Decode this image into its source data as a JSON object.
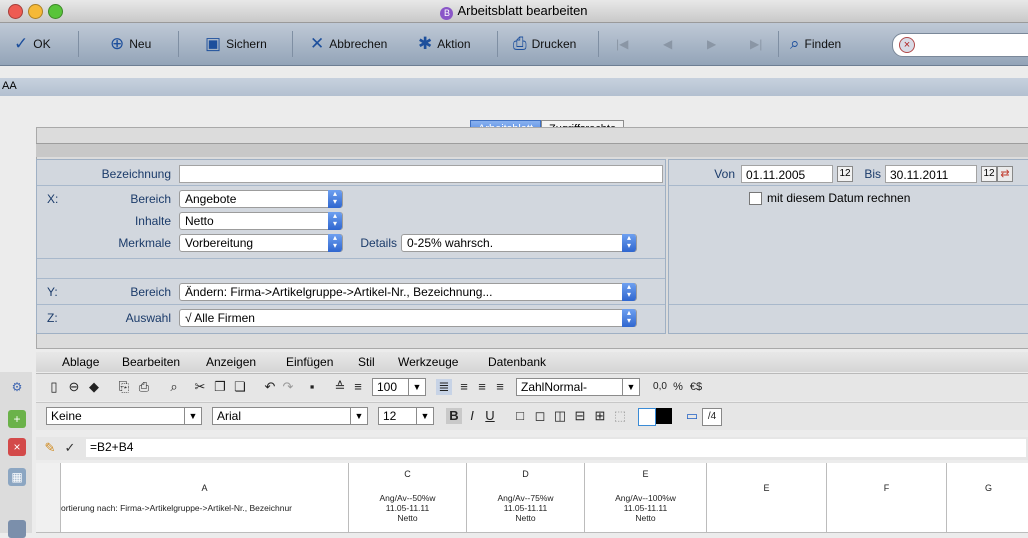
{
  "window": {
    "title": "Arbeitsblatt bearbeiten"
  },
  "toolbar": {
    "ok": "OK",
    "new": "Neu",
    "save": "Sichern",
    "cancel": "Abbrechen",
    "action": "Aktion",
    "print": "Drucken",
    "find": "Finden"
  },
  "strip": {
    "label": "AA"
  },
  "tabs": {
    "sheet": "Arbeitsblatt",
    "access": "Zugriffsrechte"
  },
  "form": {
    "bezeichnung_label": "Bezeichnung",
    "bezeichnung_value": "",
    "x_label": "X:",
    "bereich_label": "Bereich",
    "bereich_value": "Angebote",
    "inhalte_label": "Inhalte",
    "inhalte_value": "Netto",
    "merkmale_label": "Merkmale",
    "merkmale_value": "Vorbereitung",
    "details_label": "Details",
    "details_value": "0-25% wahrsch.",
    "y_label": "Y:",
    "y_bereich_label": "Bereich",
    "y_bereich_value": "Ändern: Firma->Artikelgruppe->Artikel-Nr., Bezeichnung...",
    "z_label": "Z:",
    "auswahl_label": "Auswahl",
    "auswahl_value": "√  Alle Firmen",
    "von_label": "Von",
    "von_value": "01.11.2005",
    "bis_label": "Bis",
    "bis_value": "30.11.2011",
    "date_checkbox_label": "mit diesem Datum rechnen"
  },
  "menu": [
    "Ablage",
    "Bearbeiten",
    "Anzeigen",
    "Einfügen",
    "Stil",
    "Werkzeuge",
    "Datenbank"
  ],
  "toolbar1": {
    "zoom": "100",
    "style": "ZahlNormal-",
    "num_format": "0,0",
    "percent": "%"
  },
  "toolbar2": {
    "border": "Keine",
    "font": "Arial",
    "size": "12",
    "bold": "B",
    "italic": "I",
    "underline": "U",
    "colcount": "/4"
  },
  "formula": {
    "value": "=B2+B4"
  },
  "grid": {
    "columns": [
      {
        "head": "A",
        "lines": [
          "ortierung nach: Firma->Artikelgruppe->Artikel-Nr., Bezeichnur"
        ]
      },
      {
        "head": "C",
        "lines": [
          "Ang/Av--50%w",
          "11.05-11.11",
          "Netto"
        ]
      },
      {
        "head": "D",
        "lines": [
          "Ang/Av--75%w",
          "11.05-11.11",
          "Netto"
        ]
      },
      {
        "head": "E",
        "lines": [
          "Ang/Av--100%w",
          "11.05-11.11",
          "Netto"
        ]
      },
      {
        "head": "E",
        "lines": []
      },
      {
        "head": "F",
        "lines": []
      },
      {
        "head": "G",
        "lines": []
      }
    ]
  },
  "colors": {
    "accent": "#3f7ae0",
    "label": "#1b3b6a",
    "toolbar": "#a9b7c8"
  }
}
